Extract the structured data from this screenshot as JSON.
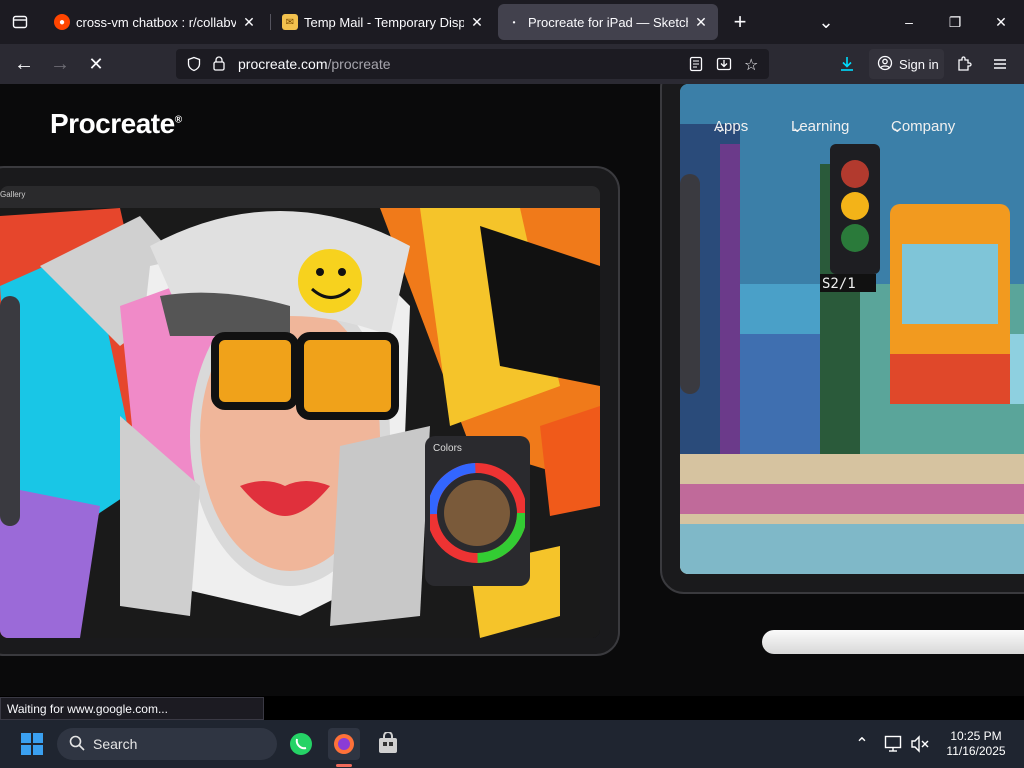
{
  "tabs": [
    {
      "title": "cross-vm chatbox : r/collabvm",
      "favicon": "reddit-icon",
      "color": "#ff4500"
    },
    {
      "title": "Temp Mail - Temporary Disposable",
      "favicon": "mail-icon",
      "color": "#f2c14e"
    },
    {
      "title": "Procreate for iPad — Sketch, Paint",
      "favicon": "procreate-icon",
      "color": "#42414d"
    }
  ],
  "toolbar": {
    "tab_close": "✕",
    "new_tab": "+",
    "tab_list": "⌄",
    "minimize": "–",
    "maximize": "❐",
    "close": "✕",
    "back": "←",
    "forward": "→",
    "stop": "✕",
    "sign_in": "Sign in"
  },
  "url": {
    "domain": "procreate.com",
    "path": "/procreate"
  },
  "site": {
    "logo": "Procreate",
    "logo_mark": "®",
    "nav": [
      "Apps",
      "Learning",
      "Company"
    ]
  },
  "app_ui": {
    "gallery": "Gallery",
    "colors_panel": "Colors",
    "sign_text": "S2/1"
  },
  "status_text": "Waiting for www.google.com...",
  "taskbar": {
    "search_label": "Search",
    "time": "10:25 PM",
    "date": "11/16/2025"
  },
  "colors": {
    "tabbar_bg": "#1c1b22",
    "navbar_bg": "#2b2a33",
    "accent": "#0df",
    "taskbar_bg": "#1f2530"
  }
}
